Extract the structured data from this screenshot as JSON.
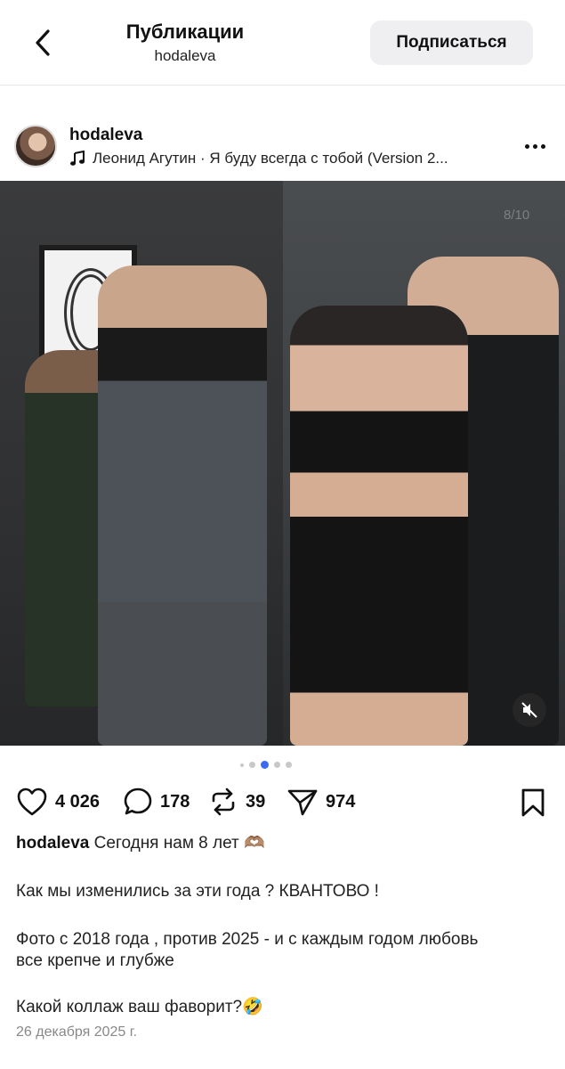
{
  "header": {
    "title": "Публикации",
    "subtitle": "hodaleva",
    "subscribe_label": "Подписаться"
  },
  "post": {
    "username": "hodaleva",
    "music": "Леонид Агутин · Я буду всегда с тобой (Version 2...",
    "counter": "8/10",
    "carousel": {
      "total_dots": 5,
      "active_index": 2
    },
    "actions": {
      "likes": "4 026",
      "comments": "178",
      "reposts": "39",
      "shares": "974"
    },
    "caption": {
      "username": "hodaleva",
      "first_line": "Сегодня нам 8 лет 🫶🏽",
      "line2": "Как мы изменились за эти года ? КВАНТОВО !",
      "line3a": "Фото с 2018 года , против 2025 - и с каждым годом любовь",
      "line3b": "все крепче и глубже",
      "line4": "Какой коллаж ваш фаворит?🤣"
    },
    "date": "26 декабря 2025 г."
  },
  "icons": {
    "back": "chevron-left-icon",
    "music": "music-note-icon",
    "more": "more-horizontal-icon",
    "mute": "muted-speaker-icon",
    "like": "heart-icon",
    "comment": "comment-bubble-icon",
    "repost": "repost-icon",
    "share": "send-icon",
    "bookmark": "bookmark-icon"
  },
  "colors": {
    "accent": "#3b6cf0",
    "button_bg": "#efeff2",
    "muted_text": "#888888"
  }
}
